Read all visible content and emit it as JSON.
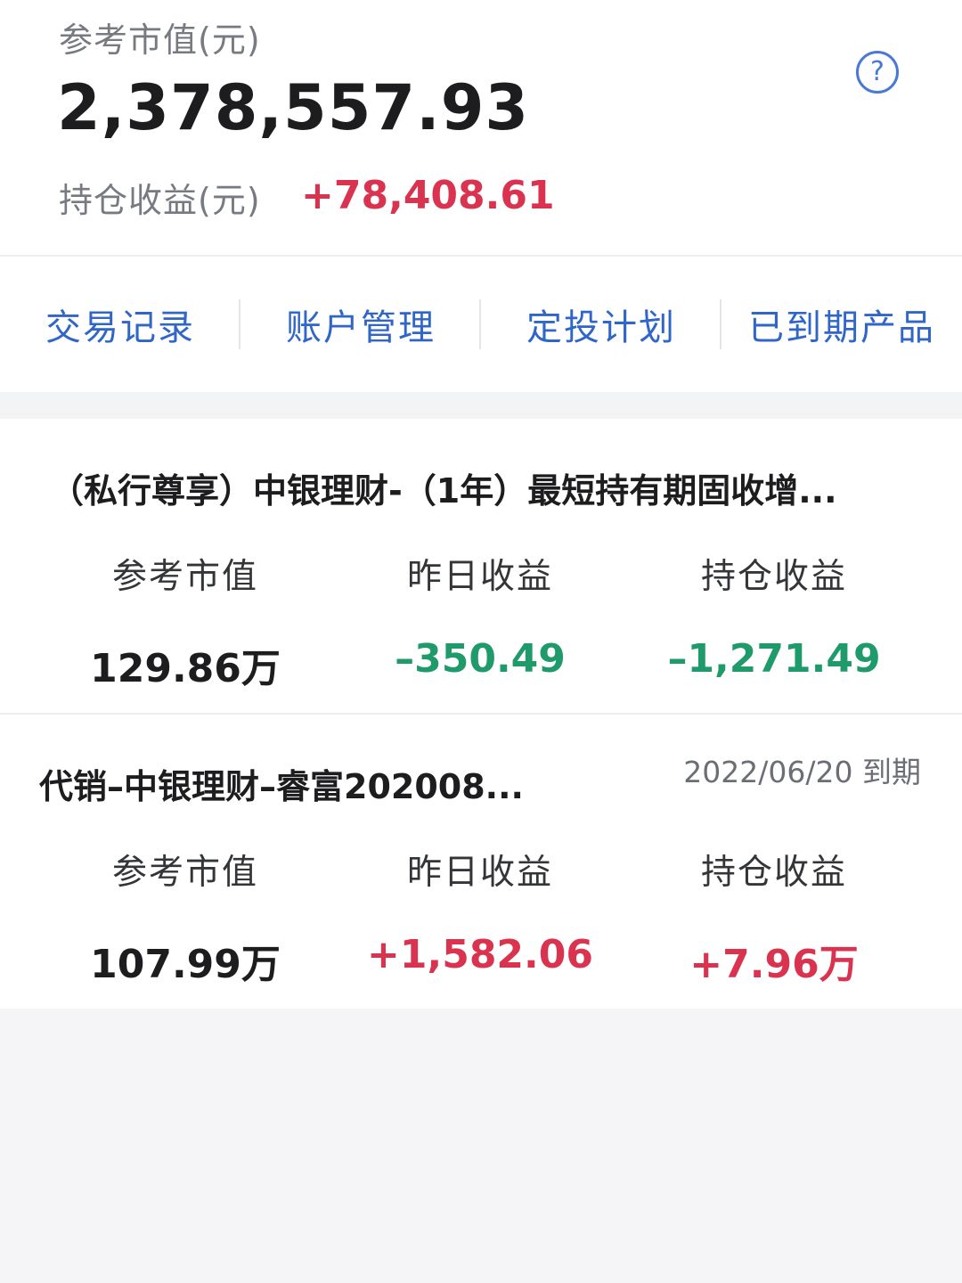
{
  "summary": {
    "market_value_label": "参考市值(元)",
    "market_value": "2,378,557.93",
    "holding_pnl_label": "持仓收益(元)",
    "holding_pnl": "+78,408.61",
    "help_icon": "?"
  },
  "nav": [
    {
      "label": "交易记录"
    },
    {
      "label": "账户管理"
    },
    {
      "label": "定投计划"
    },
    {
      "label": "已到期产品"
    }
  ],
  "products": [
    {
      "title": "（私行尊享）中银理财-（1年）最短持有期固收增...",
      "due": "",
      "metrics": [
        {
          "label": "参考市值",
          "value": "129.86万"
        },
        {
          "label": "昨日收益",
          "value": "–350.49"
        },
        {
          "label": "持仓收益",
          "value": "–1,271.49"
        }
      ]
    },
    {
      "title": "代销–中银理财–睿富202008...",
      "due": "2022/06/20 到期",
      "metrics": [
        {
          "label": "参考市值",
          "value": "107.99万"
        },
        {
          "label": "昨日收益",
          "value": "+1,582.06"
        },
        {
          "label": "持仓收益",
          "value": "+7.96万"
        }
      ]
    }
  ],
  "colors": {
    "accent": "#2f66c8",
    "gain": "#d9334f",
    "loss": "#1f9a6a"
  }
}
